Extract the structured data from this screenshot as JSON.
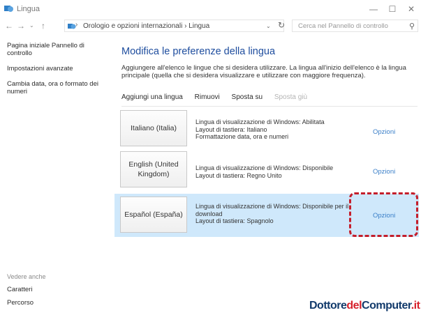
{
  "window": {
    "title": "Lingua",
    "controls": {
      "minimize": "—",
      "maximize": "☐",
      "close": "✕"
    }
  },
  "address": {
    "crumbs": "Orologio e opzioni internazionali  ›  Lingua",
    "search_placeholder": "Cerca nel Pannello di controllo"
  },
  "sidebar": {
    "links": [
      "Pagina iniziale Pannello di controllo",
      "Impostazioni avanzate",
      "Cambia data, ora o formato dei numeri"
    ],
    "see_also": "Vedere anche",
    "bottom_links": [
      "Caratteri",
      "Percorso"
    ]
  },
  "main": {
    "title": "Modifica le preferenze della lingua",
    "description": "Aggiungere all'elenco le lingue che si desidera utilizzare. La lingua all'inizio dell'elenco è la lingua principale (quella che si desidera visualizzare e utilizzare con maggiore frequenza).",
    "toolbar": {
      "add": "Aggiungi una lingua",
      "remove": "Rimuovi",
      "move_up": "Sposta su",
      "move_down": "Sposta giù"
    },
    "languages": [
      {
        "name": "Italiano (Italia)",
        "info": [
          "Lingua di visualizzazione di Windows: Abilitata",
          "Layout di tastiera: Italiano",
          "Formattazione data, ora e numeri"
        ],
        "options": "Opzioni"
      },
      {
        "name": "English (United Kingdom)",
        "info": [
          "Lingua di visualizzazione di Windows: Disponibile",
          "Layout di tastiera: Regno Unito"
        ],
        "options": "Opzioni"
      },
      {
        "name": "Español (España)",
        "info": [
          "Lingua di visualizzazione di Windows: Disponibile per il",
          "download",
          "Layout di tastiera: Spagnolo"
        ],
        "options": "Opzioni"
      }
    ]
  },
  "watermark": {
    "part1": "Dottore",
    "part2": "del",
    "part3": "Computer",
    "part4": ".it"
  },
  "colors": {
    "link": "#3a7fc8",
    "title": "#1e4d9e",
    "selected_row": "#cfe8fb",
    "highlight": "#c41e2b"
  }
}
